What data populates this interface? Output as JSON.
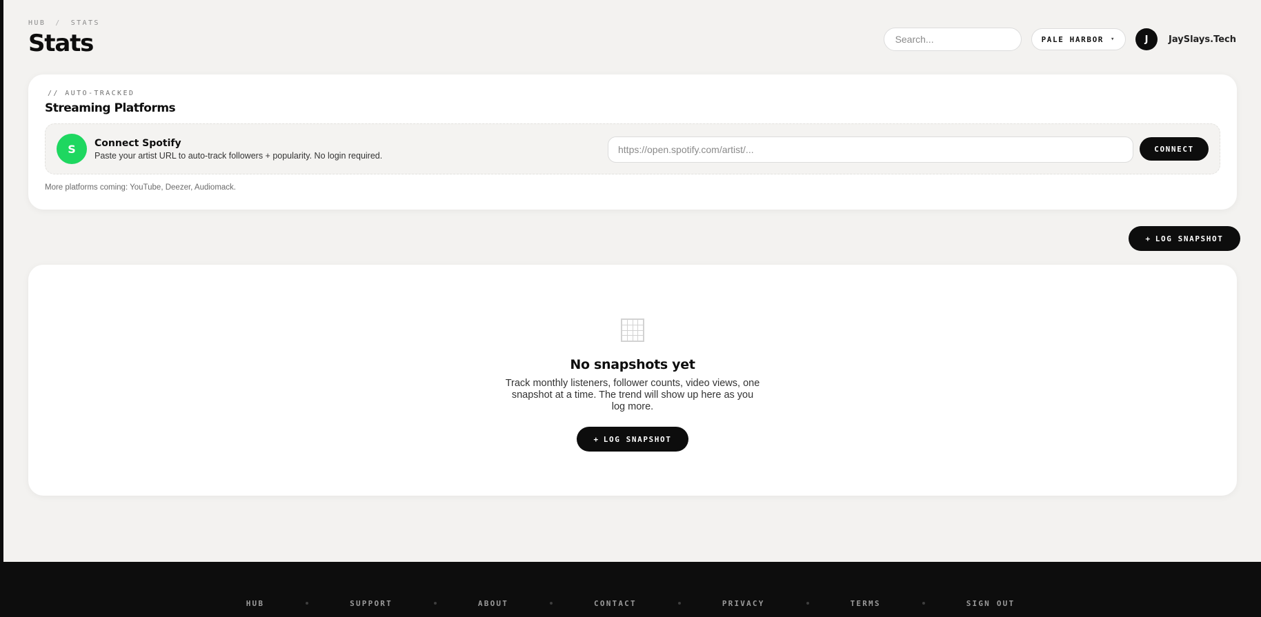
{
  "breadcrumb": {
    "root": "HUB",
    "separator": "/",
    "current": "STATS"
  },
  "header": {
    "title": "Stats",
    "search_placeholder": "Search...",
    "workspace": "PALE HARBOR",
    "workspace_caret": "▾",
    "avatar_initial": "J",
    "user_name": "JaySlays.Tech"
  },
  "platforms": {
    "eyebrow": "// AUTO-TRACKED",
    "title": "Streaming Platforms",
    "spotify": {
      "badge": "S",
      "title": "Connect Spotify",
      "description": "Paste your artist URL to auto-track followers + popularity. No login required.",
      "url_placeholder": "https://open.spotify.com/artist/...",
      "connect_label": "CONNECT"
    },
    "more_note": "More platforms coming: YouTube, Deezer, Audiomack."
  },
  "actions": {
    "log_snapshot_label": "LOG SNAPSHOT",
    "plus": "+"
  },
  "empty_state": {
    "icon": "grid-icon",
    "title": "No snapshots yet",
    "description": "Track monthly listeners, follower counts, video views, one snapshot at a time. The trend will show up here as you log more.",
    "button_label": "LOG SNAPSHOT",
    "plus": "+"
  },
  "footer": {
    "links": [
      "HUB",
      "SUPPORT",
      "ABOUT",
      "CONTACT",
      "PRIVACY",
      "TERMS",
      "SIGN OUT"
    ]
  },
  "colors": {
    "spotify_green": "#1ed760",
    "ink": "#0d0d0d",
    "canvas": "#f3f2f0"
  }
}
